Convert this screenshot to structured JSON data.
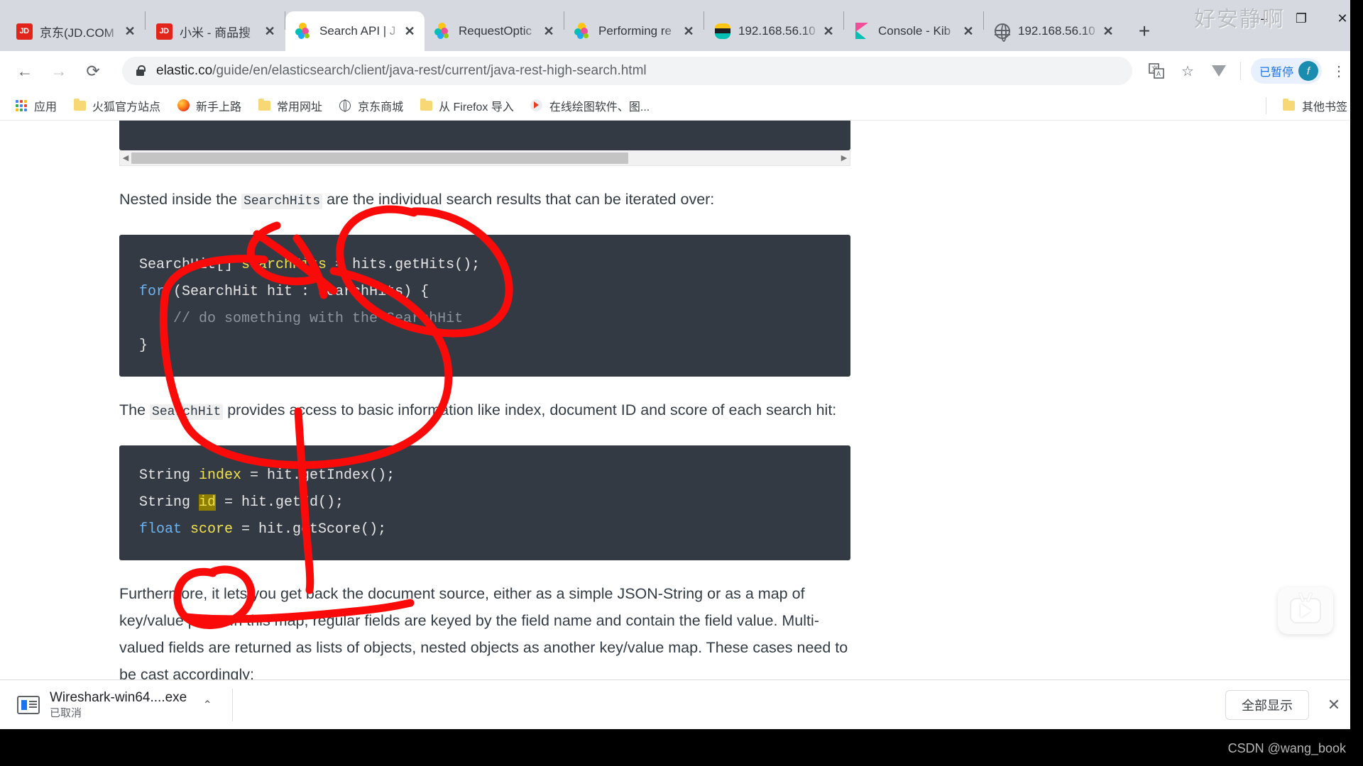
{
  "window": {
    "watermark_top": "好安静啊",
    "watermark_bottom": "CSDN @wang_book",
    "minimize": "—",
    "maximize": "❐",
    "close": "✕"
  },
  "tabs": [
    {
      "title": "京东(JD.COM",
      "favicon": "jd-icon",
      "close": "✕",
      "active": false
    },
    {
      "title": "小米 - 商品搜",
      "favicon": "jd-icon",
      "close": "✕",
      "active": false
    },
    {
      "title": "Search API | J",
      "favicon": "elastic-icon",
      "close": "✕",
      "active": true
    },
    {
      "title": "RequestOptic",
      "favicon": "elastic-icon",
      "close": "✕",
      "active": false
    },
    {
      "title": "Performing re",
      "favicon": "elastic-icon",
      "close": "✕",
      "active": false
    },
    {
      "title": "192.168.56.10",
      "favicon": "elasticsearch-icon",
      "close": "✕",
      "active": false
    },
    {
      "title": "Console - Kib",
      "favicon": "kibana-icon",
      "close": "✕",
      "active": false
    },
    {
      "title": "192.168.56.10",
      "favicon": "globe-icon",
      "close": "✕",
      "active": false
    }
  ],
  "newtab_label": "+",
  "nav": {
    "back": "←",
    "forward": "→",
    "reload": "⟳",
    "url_host": "elastic.co",
    "url_path": "/guide/en/elasticsearch/client/java-rest/current/java-rest-high-search.html",
    "url_full": "elastic.co/guide/en/elasticsearch/client/java-rest/current/java-rest-high-search.html",
    "translate_icon": "translate-icon",
    "bookmark_star": "☆",
    "extension_v": "V",
    "profile_pill_text": "已暂停",
    "avatar_letter": "f",
    "menu": "⋮"
  },
  "bookmarks": {
    "items": [
      {
        "label": "应用",
        "icon": "apps-grid-icon"
      },
      {
        "label": "火狐官方站点",
        "icon": "folder-icon"
      },
      {
        "label": "新手上路",
        "icon": "firefox-icon"
      },
      {
        "label": "常用网址",
        "icon": "folder-icon"
      },
      {
        "label": "京东商城",
        "icon": "globe-icon"
      },
      {
        "label": "从 Firefox 导入",
        "icon": "folder-icon"
      },
      {
        "label": "在线绘图软件、图...",
        "icon": "draw-icon"
      }
    ],
    "other": {
      "label": "其他书签",
      "icon": "folder-icon"
    }
  },
  "page": {
    "para1_before": "Nested inside the ",
    "para1_code": "SearchHits",
    "para1_after": " are the individual search results that can be iterated over:",
    "code1": {
      "line1_type": "SearchHit[] ",
      "line1_var": "searchHits",
      "line1_rest": " = hits.getHits();",
      "line2_kw": "for",
      "line2_rest": " (SearchHit hit : searchHits) {",
      "line3_comment": "    // do something with the SearchHit",
      "line4": "}"
    },
    "para2_before": "The ",
    "para2_code": "SearchHit",
    "para2_after": " provides access to basic information like index, document ID and score of each search hit:",
    "code2": {
      "l1_type": "String ",
      "l1_var": "index",
      "l1_rest": " = hit.getIndex();",
      "l2_type": "String ",
      "l2_var": "id",
      "l2_rest": " = hit.getId();",
      "l3_kw": "float",
      "l3_var": " score",
      "l3_rest": " = hit.getScore();"
    },
    "para3": "Furthermore, it lets you get back the document source, either as a simple JSON-String or as a map of key/value pairs. In this map, regular fields are keyed by the field name and contain the field value. Multi-valued fields are returned as lists of objects, nested objects as another key/value map. These cases need to be cast accordingly:",
    "hscroll_left": "◀",
    "hscroll_right": "▶"
  },
  "scrollbar": {
    "up": "▲",
    "down": "▼"
  },
  "video_badge": {
    "icon": "video-play-icon"
  },
  "download_shelf": {
    "file_name": "Wireshark-win64....exe",
    "file_status": "已取消",
    "caret": "⌃",
    "show_all_label": "全部显示",
    "close": "✕"
  },
  "colors": {
    "annotation_red": "#fb0a0a",
    "code_bg": "#343a44",
    "accent_blue": "#1a73e8",
    "keyword_blue": "#6cb3f0",
    "var_yellow": "#f2e14c"
  }
}
